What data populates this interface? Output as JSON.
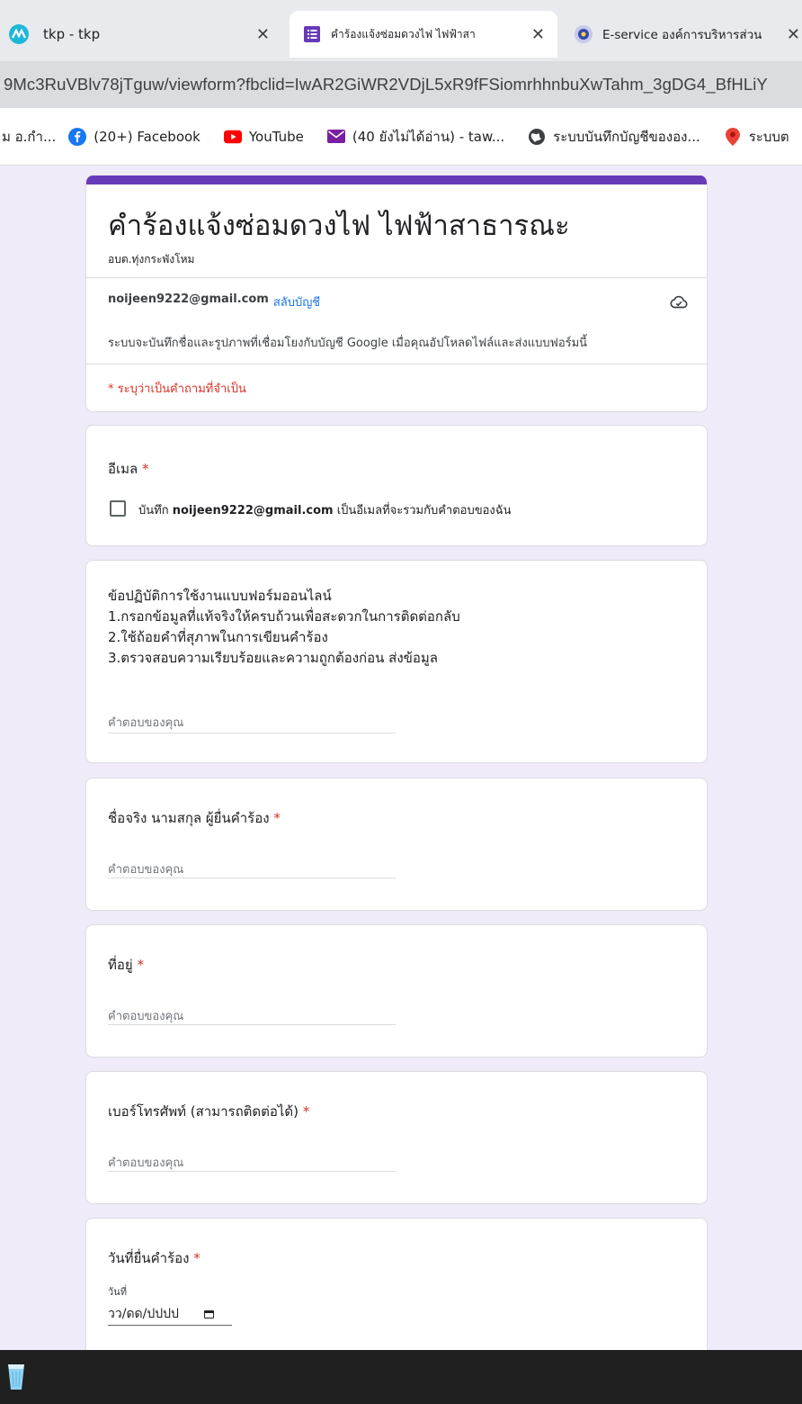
{
  "browser": {
    "tabs": [
      {
        "title": "tkp - tkp",
        "close": "✕",
        "icon": "tkp-favicon",
        "active": false
      },
      {
        "title": "คำร้องแจ้งซ่อมดวงไฟ ไฟฟ้าสา",
        "close": "✕",
        "icon": "google-forms-icon",
        "active": true
      },
      {
        "title": "E-service องค์การบริหารส่วน",
        "close": "✕",
        "icon": "eservice-favicon",
        "active": false
      }
    ],
    "url": "9Mc3RuVBlv78jTguw/viewform?fbclid=IwAR2GiWR2VDjL5xR9fFSiomrhhnbuXwTahm_3gDG4_BfHLiY",
    "bookmarks": [
      {
        "label": "ม อ.กำ...",
        "icon": ""
      },
      {
        "label": "(20+) Facebook",
        "icon": "facebook-icon"
      },
      {
        "label": "YouTube",
        "icon": "youtube-icon"
      },
      {
        "label": "(40 ยังไม่ได้อ่าน) - taw...",
        "icon": "gmail-icon"
      },
      {
        "label": "ระบบบันทึกบัญชีขององ...",
        "icon": "globe-icon"
      },
      {
        "label": "ระบบต",
        "icon": "maps-pin-icon"
      }
    ]
  },
  "form": {
    "title": "คำร้องแจ้งซ่อมดวงไฟ ไฟฟ้าสาธารณะ",
    "subtitle": "อบต.ทุ่งกระพังโหม",
    "account_email": "noijeen9222@gmail.com",
    "switch_account": "สลับบัญชี",
    "notice": "ระบบจะบันทึกชื่อและรูปภาพที่เชื่อมโยงกับบัญชี Google เมื่อคุณอัปโหลดไฟล์และส่งแบบฟอร์มนี้",
    "required_note": "* ระบุว่าเป็นคำถามที่จำเป็น",
    "email_question": {
      "label": "อีเมล",
      "required_mark": "*",
      "checkbox_prefix": "บันทึก",
      "checkbox_email": "noijeen9222@gmail.com",
      "checkbox_suffix": "เป็นอีเมลที่จะรวมกับคำตอบของฉัน"
    },
    "rules_question": {
      "lines": [
        "ข้อปฏิบัติการใช้งานแบบฟอร์มออนไลน์",
        "1.กรอกข้อมูลที่แท้จริงให้ครบถ้วนเพื่อสะดวกในการติดต่อกลับ",
        "2.ใช้ถ้อยคำที่สุภาพในการเขียนคำร้อง",
        "3.ตรวจสอบความเรียบร้อยและความถูกต้องก่อน ส่งข้อมูล"
      ],
      "placeholder": "คำตอบของคุณ"
    },
    "name_question": {
      "label": "ชื่อจริง นามสกุล  ผู้ยื่นคำร้อง",
      "required_mark": "*",
      "placeholder": "คำตอบของคุณ"
    },
    "address_question": {
      "label": "ที่อยู่ ",
      "required_mark": "*",
      "placeholder": "คำตอบของคุณ"
    },
    "phone_question": {
      "label": "เบอร์โทรศัพท์ (สามารถติดต่อได้)",
      "required_mark": "*",
      "placeholder": "คำตอบของคุณ"
    },
    "date_question": {
      "label": "วันที่ยื่นคำร้อง",
      "required_mark": "*",
      "caption": "วันที่",
      "value": "วว/ดด/ปปปป"
    }
  },
  "colors": {
    "accent": "#673ab7",
    "required": "#d93025",
    "link": "#1a73e8",
    "background": "#f0ebf8"
  }
}
